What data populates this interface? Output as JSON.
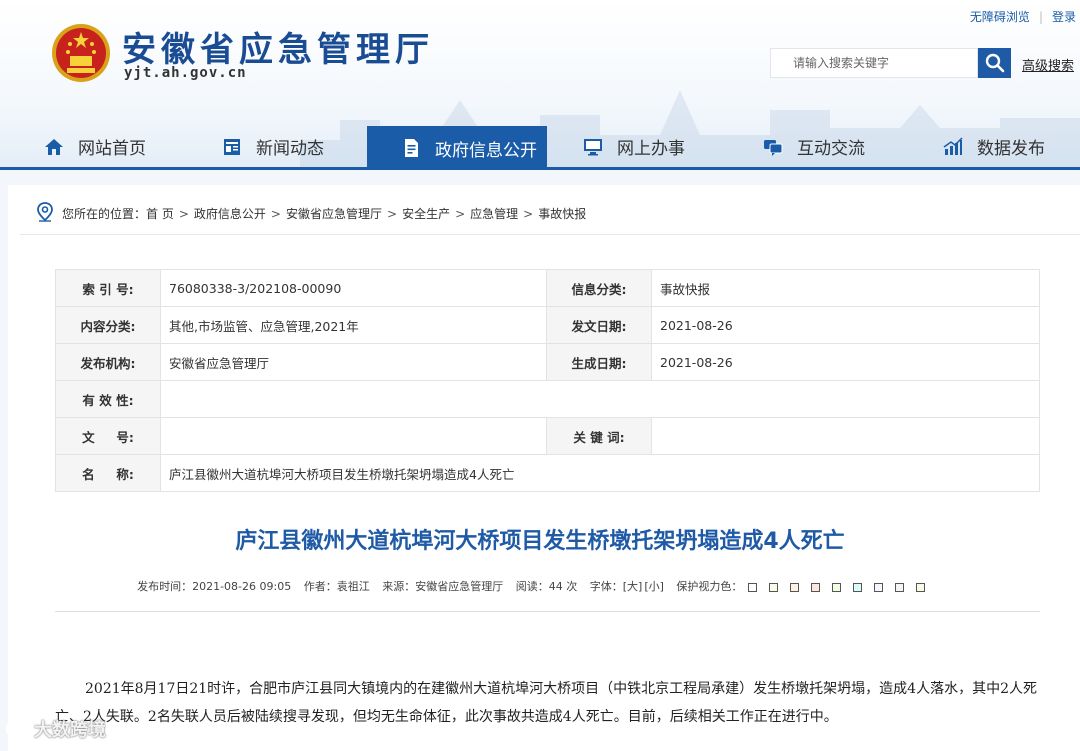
{
  "header": {
    "site_title": "安徽省应急管理厅",
    "site_domain": "yjt.ah.gov.cn",
    "top_links": [
      "无障碍浏览",
      "登录"
    ],
    "search_placeholder": "请输入搜索关键字",
    "advanced_search": "高级搜索"
  },
  "nav": {
    "items": [
      {
        "label": "网站首页",
        "icon": "home-icon"
      },
      {
        "label": "新闻动态",
        "icon": "news-icon"
      },
      {
        "label": "政府信息公开",
        "icon": "document-icon",
        "active": true
      },
      {
        "label": "网上办事",
        "icon": "monitor-icon"
      },
      {
        "label": "互动交流",
        "icon": "chat-icon"
      },
      {
        "label": "数据发布",
        "icon": "chart-icon"
      }
    ],
    "accent": "#1a5ca8"
  },
  "breadcrumb": {
    "prefix": "您所在的位置：",
    "items": [
      "首 页",
      "政府信息公开",
      "安徽省应急管理厅",
      "安全生产",
      "应急管理",
      "事故快报"
    ],
    "separator": ">"
  },
  "info": {
    "index_label": "索 引 号:",
    "index_value": "76080338-3/202108-00090",
    "category_label": "信息分类:",
    "category_value": "事故快报",
    "content_label": "内容分类:",
    "content_value": "其他,市场监管、应急管理,2021年",
    "issue_date_label": "发文日期:",
    "issue_date_value": "2021-08-26",
    "publisher_label": "发布机构:",
    "publisher_value": "安徽省应急管理厅",
    "gen_date_label": "生成日期:",
    "gen_date_value": "2021-08-26",
    "validity_label": "有 效 性:",
    "validity_value": "",
    "docno_label": "文     号:",
    "docno_value": "",
    "keywords_label": "关 键 词:",
    "keywords_value": "",
    "name_label": "名     称:",
    "name_value": "庐江县徽州大道杭埠河大桥项目发生桥墩托架坍塌造成4人死亡"
  },
  "article": {
    "title": "庐江县徽州大道杭埠河大桥项目发生桥墩托架坍塌造成4人死亡",
    "publish_time": "发布时间：2021-08-26 09:05",
    "author": "作者：袁祖江",
    "source": "来源：安徽省应急管理厅",
    "reads": "阅读：44 次",
    "font_label": "字体：",
    "font_large": "[大]",
    "font_small": "[小]",
    "eye_label": "保护视力色：",
    "eye_colors": [
      "#ffffff",
      "#fafbe6",
      "#fff2e2",
      "#fde6e0",
      "#f3ffe1",
      "#dafaf8",
      "#f3f6ff",
      "#f5f5f5",
      "#fafbe6"
    ],
    "body": "2021年8月17日21时许，合肥市庐江县同大镇境内的在建徽州大道杭埠河大桥项目（中铁北京工程局承建）发生桥墩托架坍塌，造成4人落水，其中2人死亡、2人失联。2名失联人员后被陆续搜寻发现，但均无生命体征，此次事故共造成4人死亡。目前，后续相关工作正在进行中。"
  },
  "watermark": "大数跨境"
}
